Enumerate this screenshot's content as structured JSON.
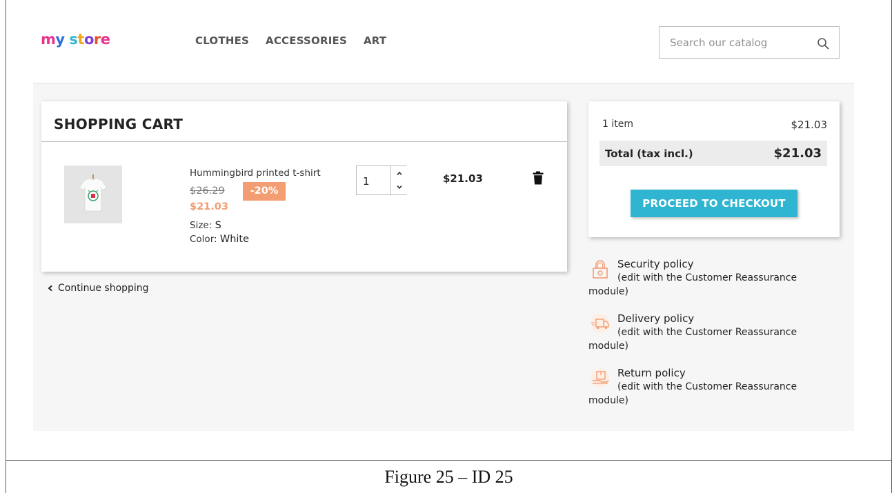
{
  "header": {
    "logo": {
      "parts": [
        "m",
        "y",
        " ",
        "s",
        "t",
        "o",
        "r",
        "e"
      ],
      "colors": [
        "#e8338d",
        "#2a6fdb",
        "",
        "#2fb5d2",
        "#f2a51a",
        "#7d3fd1",
        "#e84f2a",
        "#e8338d"
      ]
    },
    "nav": [
      "CLOTHES",
      "ACCESSORIES",
      "ART"
    ],
    "search_placeholder": "Search our catalog"
  },
  "cart": {
    "title": "SHOPPING CART",
    "item": {
      "name": "Hummingbird printed t-shirt",
      "old_price": "$26.29",
      "discount": "-20%",
      "new_price": "$21.03",
      "size_label": "Size:",
      "size_value": "S",
      "color_label": "Color:",
      "color_value": "White",
      "quantity": "1",
      "total": "$21.03"
    },
    "continue_label": "Continue shopping"
  },
  "summary": {
    "items_label": "1 item",
    "items_value": "$21.03",
    "total_label": "Total (tax incl.)",
    "total_value": "$21.03",
    "checkout_label": "PROCEED TO CHECKOUT"
  },
  "reassurance": [
    {
      "title": "Security policy",
      "desc": "(edit with the Customer Reassurance module)",
      "icon": "lock-icon"
    },
    {
      "title": "Delivery policy",
      "desc": "(edit with the Customer Reassurance module)",
      "icon": "truck-icon"
    },
    {
      "title": "Return policy",
      "desc": "(edit with the Customer Reassurance module)",
      "icon": "return-box-icon"
    }
  ],
  "colors": {
    "accent": "#2fb5d2",
    "discount": "#f39d72",
    "reassurance_icon": "#f39d72"
  },
  "caption": "Figure 25 – ID 25"
}
